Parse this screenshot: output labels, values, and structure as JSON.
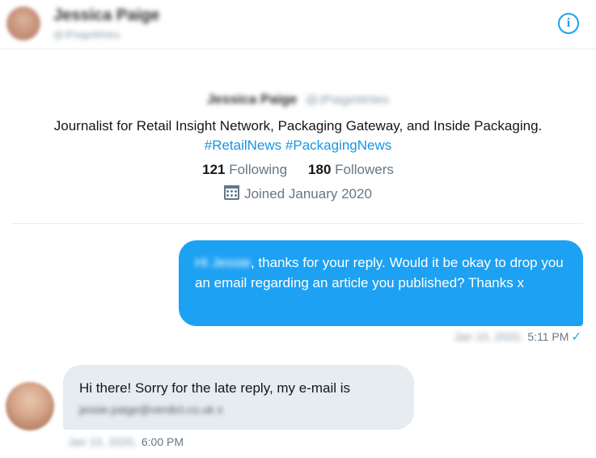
{
  "header": {
    "name": "Jessica Paige",
    "handle": "@JPaigeWrites",
    "info_icon": "info-icon",
    "info_glyph": "i"
  },
  "profile": {
    "name": "Jessica Paige",
    "handle": "@JPaigeWrites",
    "bio": "Journalist for Retail Insight Network, Packaging Gateway, and Inside Packaging.",
    "hashtags": [
      "#RetailNews",
      "#PackagingNews"
    ],
    "following_count": "121",
    "following_label": "Following",
    "followers_count": "180",
    "followers_label": "Followers",
    "calendar_icon": "calendar-icon",
    "joined": "Joined January 2020"
  },
  "messages": [
    {
      "direction": "sent",
      "greeting": "Hi Jessie",
      "text": ", thanks for your reply. Would it be okay to drop you an email regarding an article you published? Thanks x",
      "date": "Jan 10, 2020,",
      "time": "5:11 PM",
      "status_icon": "checkmark-icon",
      "status_glyph": "✓"
    },
    {
      "direction": "received",
      "text": "Hi there! Sorry for the late reply, my e-mail is",
      "email": "jessie.paige@verdict.co.uk x",
      "date": "Jan 10, 2020,",
      "time": "6:00 PM"
    }
  ],
  "colors": {
    "accent": "#1da1f2",
    "hashtag": "#1b95e0",
    "received_bubble": "#e6ecf0",
    "secondary_text": "#657786"
  }
}
